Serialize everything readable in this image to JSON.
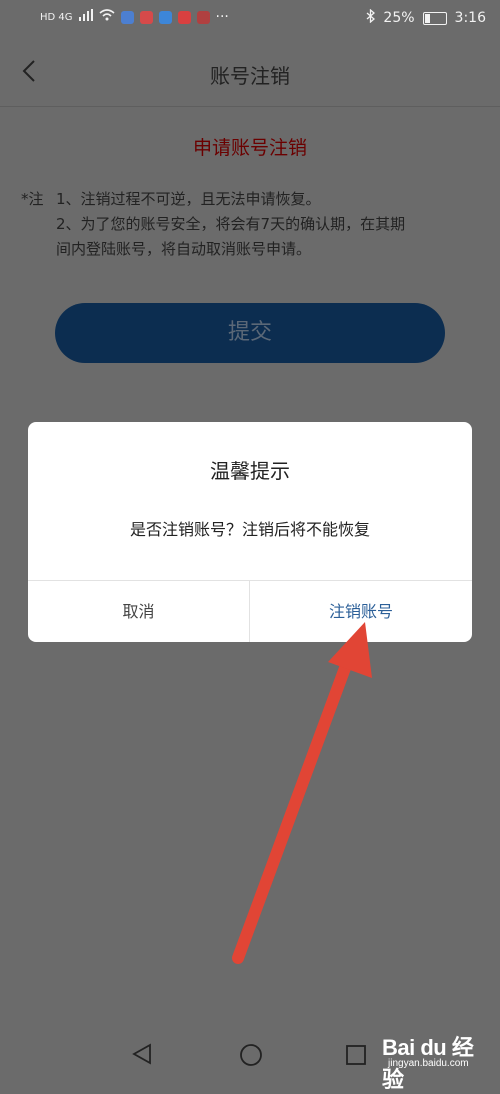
{
  "status_bar": {
    "left_indicators": "HD 4G",
    "battery": "25%",
    "time": "3:16"
  },
  "header": {
    "title": "账号注销"
  },
  "page": {
    "apply_title": "申请账号注销",
    "note_prefix": "*注",
    "note_1": "1、注销过程不可逆，且无法申请恢复。",
    "note_2a": "2、为了您的账号安全，将会有7天的确认期，在其期",
    "note_2b": "间内登陆账号，将自动取消账号申请。",
    "submit_label": "提交"
  },
  "dialog": {
    "title": "温馨提示",
    "message": "是否注销账号？注销后将不能恢复",
    "cancel_label": "取消",
    "confirm_label": "注销账号"
  },
  "watermark": {
    "logo_text": "Bai du 经验",
    "url": "jingyan.baidu.com"
  },
  "colors": {
    "overlay_bg": "#6b6b6b",
    "apply_title": "#6b0000",
    "submit_bg": "#0c2d50",
    "confirm_text": "#2b5f98",
    "arrow": "#e14535"
  }
}
